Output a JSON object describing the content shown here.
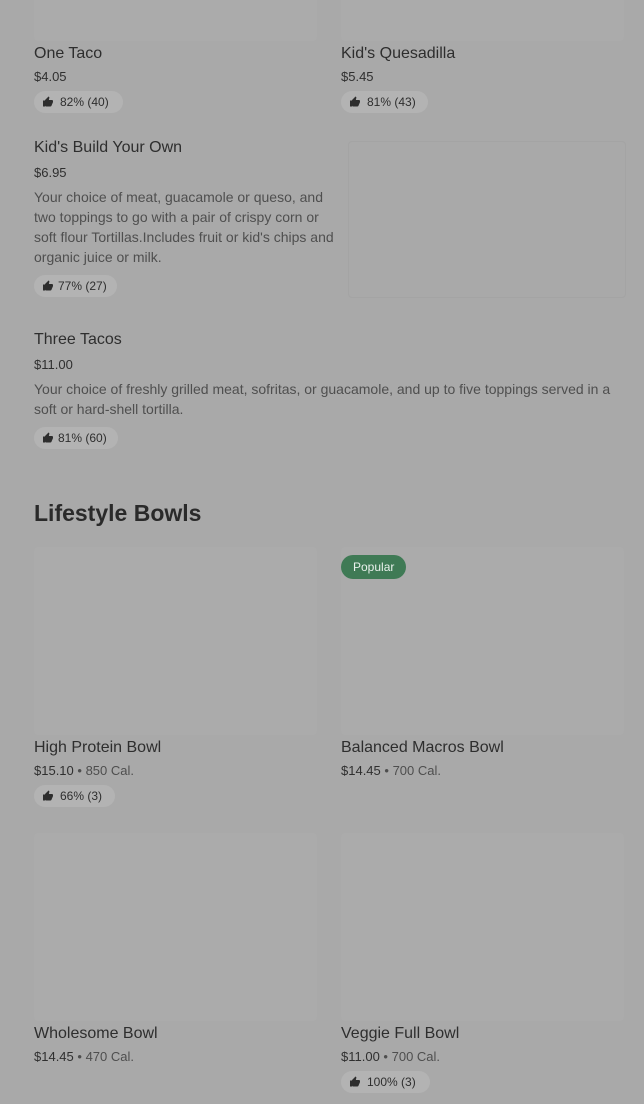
{
  "menu_top": [
    {
      "title": "One Taco",
      "price": "$4.05",
      "rating": "82% (40)"
    },
    {
      "title": "Kid's Quesadilla",
      "price": "$5.45",
      "rating": "81% (43)"
    }
  ],
  "kids_build": {
    "title": "Kid's Build Your Own",
    "price": "$6.95",
    "description": "Your choice of meat, guacamole or queso, and two toppings to go with a pair of crispy corn or soft flour Tortillas.Includes fruit or kid's chips and organic juice or milk.",
    "rating": "77% (27)"
  },
  "three_tacos": {
    "title": "Three Tacos",
    "price": "$11.00",
    "description": "Your choice of freshly grilled meat, sofritas, or guacamole, and up to five toppings served in a soft or hard-shell tortilla.",
    "rating": "81% (60)"
  },
  "section": {
    "title": "Lifestyle Bowls"
  },
  "badge": {
    "popular": "Popular"
  },
  "bowls": [
    {
      "title": "High Protein Bowl",
      "price": "$15.10",
      "sep": "•",
      "cal": "850 Cal.",
      "rating": "66% (3)"
    },
    {
      "title": "Balanced Macros Bowl",
      "price": "$14.45",
      "sep": "•",
      "cal": "700 Cal."
    },
    {
      "title": "Wholesome Bowl",
      "price": "$14.45",
      "sep": "•",
      "cal": "470 Cal."
    },
    {
      "title": "Veggie Full Bowl",
      "price": "$11.00",
      "sep": "•",
      "cal": "700 Cal.",
      "rating": "100% (3)"
    }
  ],
  "icons": {
    "thumbs_up": "thumbs-up-icon"
  },
  "colors": {
    "badge_bg": "#3f7a55",
    "page_bg": "#a9a9a9"
  }
}
